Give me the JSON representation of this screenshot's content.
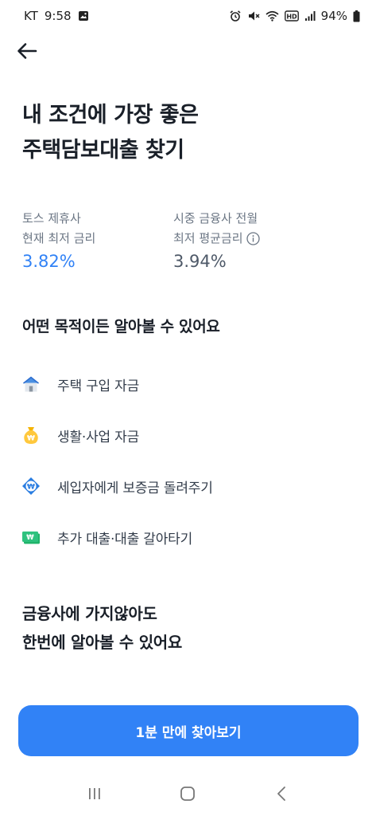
{
  "status_bar": {
    "carrier": "KT",
    "time": "9:58",
    "battery": "94%"
  },
  "header": {
    "back_icon": "arrow-left-icon",
    "title": "내 조건에 가장 좋은\n주택담보대출 찾기"
  },
  "rates": {
    "toss": {
      "label_line1": "토스 제휴사",
      "label_line2": "현재 최저 금리",
      "value": "3.82%"
    },
    "market": {
      "label_line1": "시중 금융사 전월",
      "label_line2": "최저 평균금리",
      "value": "3.94%"
    }
  },
  "purpose": {
    "title": "어떤 목적이든 알아볼 수 있어요",
    "items": [
      {
        "label": "주택 구입 자금",
        "icon": "house-icon"
      },
      {
        "label": "생활·사업 자금",
        "icon": "money-bag-icon"
      },
      {
        "label": "세입자에게 보증금 돌려주기",
        "icon": "won-coin-icon"
      },
      {
        "label": "추가 대출·대출 갈아타기",
        "icon": "banknote-icon"
      }
    ]
  },
  "subheadline": "금융사에 가지않아도\n한번에 알아볼 수 있어요",
  "cta": {
    "label": "1분 만에 찾아보기"
  },
  "colors": {
    "accent": "#3182f6",
    "text_primary": "#191f28",
    "text_secondary": "#6b7684"
  }
}
